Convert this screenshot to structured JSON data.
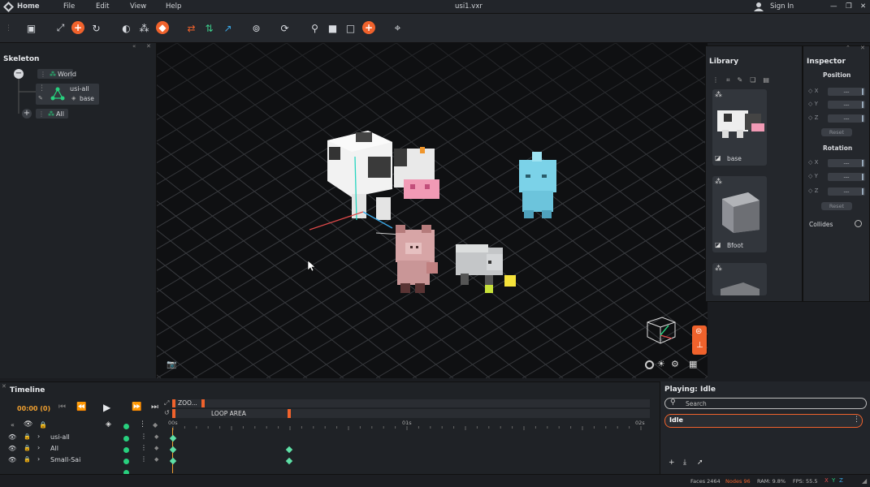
{
  "menubar": {
    "home_label": "Home",
    "menu_items": [
      "File",
      "Edit",
      "View",
      "Help"
    ],
    "document_title": "usi1.vxr",
    "sign_in_label": "Sign In",
    "window_controls": [
      "minimize-icon",
      "maximize-icon",
      "close-icon"
    ]
  },
  "toolbar": {
    "tools": [
      "save-icon",
      "expand-icon",
      "add-icon",
      "refresh-icon",
      "sphere-icon",
      "nodes-icon",
      "cube-orange-icon",
      "swap-red-icon",
      "updown-green-icon",
      "flip-blue-icon",
      "layers-icon",
      "rotate-icon",
      "tree-icon",
      "box-icon",
      "box-outline-icon",
      "add-icon",
      "crosshair-icon"
    ]
  },
  "skeleton": {
    "title": "Skeleton",
    "world_label": "World",
    "child_label": "usi-all",
    "child_sub_label": "base",
    "all_label": "All"
  },
  "library": {
    "title": "Library",
    "items": [
      {
        "name": "base"
      },
      {
        "name": "Bfoot"
      },
      {
        "name": ""
      }
    ]
  },
  "inspector": {
    "title": "Inspector",
    "position_label": "Position",
    "rotation_label": "Rotation",
    "axes": [
      "X",
      "Y",
      "Z"
    ],
    "field_value": "---",
    "reset_label": "Reset",
    "collides_label": "Collides"
  },
  "timeline": {
    "title": "Timeline",
    "time_display": "00:00 (0)",
    "zoom_label": "ZOO...",
    "loop_label": "LOOP AREA",
    "ticks": [
      "00s",
      "01s",
      "02s"
    ],
    "rows": [
      {
        "name": "usi-all"
      },
      {
        "name": "All"
      },
      {
        "name": "Small-Sai"
      }
    ]
  },
  "playing": {
    "title": "Playing: Idle",
    "search_placeholder": "Search",
    "animations": [
      "Idle"
    ]
  },
  "status": {
    "faces": "Faces 2464",
    "nodes": "Nodes 96",
    "ram": "RAM: 9.8%",
    "fps": "FPS: 55.5",
    "axes": [
      "X",
      "Y",
      "Z"
    ]
  },
  "colors": {
    "accent": "#f0622c",
    "green": "#28d07e",
    "blue": "#3aa8e8",
    "panel": "#24272c"
  }
}
